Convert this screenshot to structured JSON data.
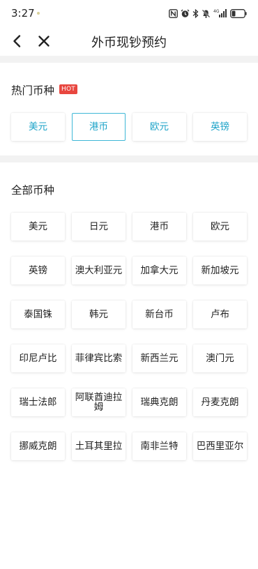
{
  "status_bar": {
    "time": "3:27",
    "network": "4G",
    "icons": [
      "nfc-icon",
      "alarm-icon",
      "bluetooth-icon",
      "mute-icon",
      "signal-icon",
      "battery-icon"
    ]
  },
  "nav": {
    "title": "外币现钞预约",
    "back_icon": "chevron-left-icon",
    "close_icon": "close-icon"
  },
  "hot_section": {
    "title": "热门币种",
    "badge": "HOT",
    "accent_color": "#1ca3c8",
    "badge_color": "#e8463f",
    "items": [
      {
        "label": "美元"
      },
      {
        "label": "港币",
        "selected": true
      },
      {
        "label": "欧元"
      },
      {
        "label": "英镑"
      }
    ]
  },
  "all_section": {
    "title": "全部币种",
    "items": [
      {
        "label": "美元"
      },
      {
        "label": "日元"
      },
      {
        "label": "港币"
      },
      {
        "label": "欧元"
      },
      {
        "label": "英镑"
      },
      {
        "label": "澳大利亚元"
      },
      {
        "label": "加拿大元"
      },
      {
        "label": "新加坡元"
      },
      {
        "label": "泰国铢"
      },
      {
        "label": "韩元"
      },
      {
        "label": "新台币"
      },
      {
        "label": "卢布"
      },
      {
        "label": "印尼卢比"
      },
      {
        "label": "菲律宾比索"
      },
      {
        "label": "新西兰元"
      },
      {
        "label": "澳门元"
      },
      {
        "label": "瑞士法郎"
      },
      {
        "label": "阿联酋迪拉姆"
      },
      {
        "label": "瑞典克朗"
      },
      {
        "label": "丹麦克朗"
      },
      {
        "label": "挪威克朗"
      },
      {
        "label": "土耳其里拉"
      },
      {
        "label": "南非兰特"
      },
      {
        "label": "巴西里亚尔"
      }
    ]
  }
}
